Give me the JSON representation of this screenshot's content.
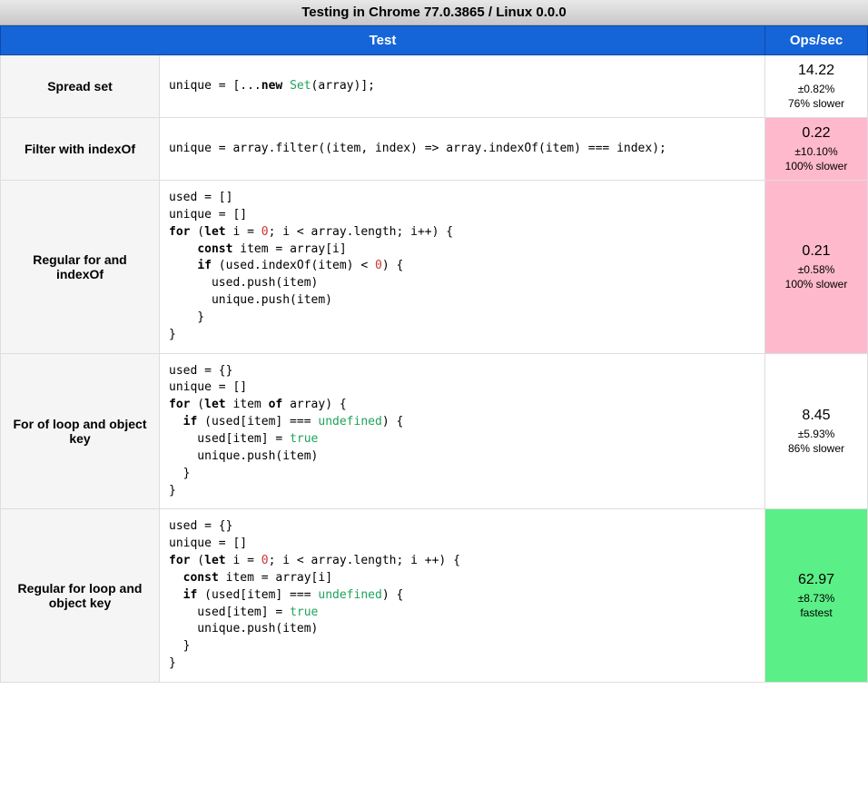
{
  "title": "Testing in Chrome 77.0.3865 / Linux 0.0.0",
  "columns": {
    "test": "Test",
    "ops": "Ops/sec"
  },
  "rows": [
    {
      "name": "Spread set",
      "code_tokens": [
        {
          "t": "unique = [..."
        },
        {
          "t": "new ",
          "c": "kw"
        },
        {
          "t": "Set",
          "c": "cls"
        },
        {
          "t": "(array)];"
        }
      ],
      "ops": "14.22",
      "pm": "±0.82%",
      "note": "76% slower",
      "cell": "bg-normal"
    },
    {
      "name": "Filter with indexOf",
      "code_tokens": [
        {
          "t": "unique = array.filter((item, index) => array.indexOf(item) === index);"
        }
      ],
      "ops": "0.22",
      "pm": "±10.10%",
      "note": "100% slower",
      "cell": "bg-slowest"
    },
    {
      "name": "Regular for and indexOf",
      "code_tokens": [
        {
          "t": "used = []\nunique = []\n"
        },
        {
          "t": "for",
          "c": "kw"
        },
        {
          "t": " ("
        },
        {
          "t": "let",
          "c": "kw"
        },
        {
          "t": " i = "
        },
        {
          "t": "0",
          "c": "num"
        },
        {
          "t": "; i < array.length; i++) {\n    "
        },
        {
          "t": "const",
          "c": "kw"
        },
        {
          "t": " item = array[i]\n    "
        },
        {
          "t": "if",
          "c": "kw"
        },
        {
          "t": " (used.indexOf(item) < "
        },
        {
          "t": "0",
          "c": "num"
        },
        {
          "t": ") {\n      used.push(item)\n      unique.push(item)\n    }\n}"
        }
      ],
      "ops": "0.21",
      "pm": "±0.58%",
      "note": "100% slower",
      "cell": "bg-slowest"
    },
    {
      "name": "For of loop and object key",
      "code_tokens": [
        {
          "t": "used = {}\nunique = []\n"
        },
        {
          "t": "for",
          "c": "kw"
        },
        {
          "t": " ("
        },
        {
          "t": "let",
          "c": "kw"
        },
        {
          "t": " item "
        },
        {
          "t": "of",
          "c": "kw"
        },
        {
          "t": " array) {\n  "
        },
        {
          "t": "if",
          "c": "kw"
        },
        {
          "t": " (used[item] === "
        },
        {
          "t": "undefined",
          "c": "lit"
        },
        {
          "t": ") {\n    used[item] = "
        },
        {
          "t": "true",
          "c": "lit"
        },
        {
          "t": "\n    unique.push(item)\n  }\n}"
        }
      ],
      "ops": "8.45",
      "pm": "±5.93%",
      "note": "86% slower",
      "cell": "bg-normal"
    },
    {
      "name": "Regular for loop and object key",
      "code_tokens": [
        {
          "t": "used = {}\nunique = []\n"
        },
        {
          "t": "for",
          "c": "kw"
        },
        {
          "t": " ("
        },
        {
          "t": "let",
          "c": "kw"
        },
        {
          "t": " i = "
        },
        {
          "t": "0",
          "c": "num"
        },
        {
          "t": "; i < array.length; i ++) {\n  "
        },
        {
          "t": "const",
          "c": "kw"
        },
        {
          "t": " item = array[i]\n  "
        },
        {
          "t": "if",
          "c": "kw"
        },
        {
          "t": " (used[item] === "
        },
        {
          "t": "undefined",
          "c": "lit"
        },
        {
          "t": ") {\n    used[item] = "
        },
        {
          "t": "true",
          "c": "lit"
        },
        {
          "t": "\n    unique.push(item)\n  }\n}"
        }
      ],
      "ops": "62.97",
      "pm": "±8.73%",
      "note": "fastest",
      "cell": "bg-fastest"
    }
  ]
}
